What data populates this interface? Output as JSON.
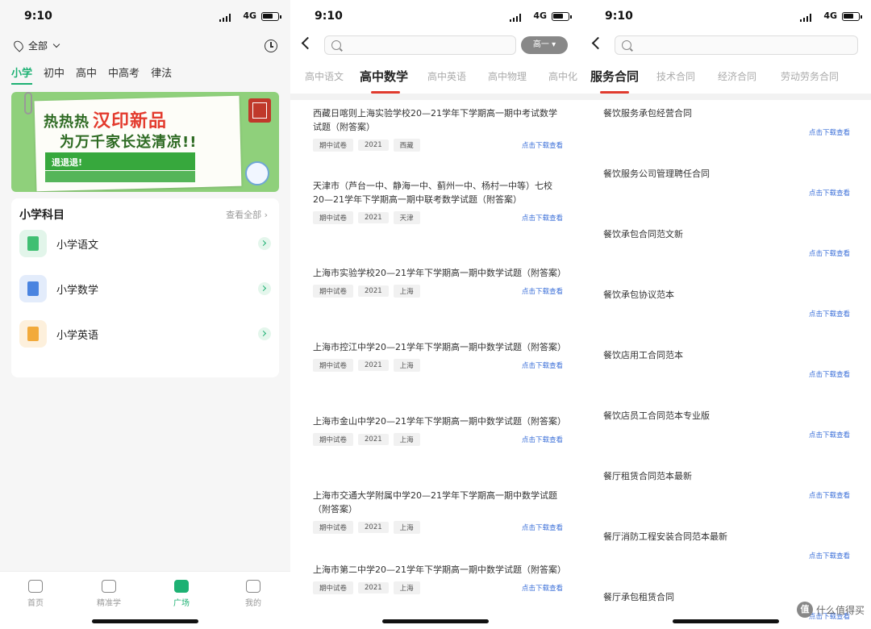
{
  "status": {
    "time": "9:10",
    "network": "4G"
  },
  "home": {
    "location": "全部",
    "level_tabs": [
      "小学",
      "初中",
      "高中",
      "中高考",
      "律法"
    ],
    "active_level": 0,
    "banner": {
      "prefix": "热热热",
      "title": "汉印新品",
      "subtitle": "为万千家长送清凉!!",
      "strip": "退退退!"
    },
    "subjects_title": "小学科目",
    "view_all": "查看全部",
    "subjects": [
      {
        "label": "小学语文",
        "icon": "book-icon",
        "color": "green"
      },
      {
        "label": "小学数学",
        "icon": "calculator-icon",
        "color": "blue"
      },
      {
        "label": "小学英语",
        "icon": "notebook-icon",
        "color": "orange"
      }
    ],
    "tabbar": [
      {
        "label": "首页",
        "icon": "home-icon"
      },
      {
        "label": "精准学",
        "icon": "graduation-cap-icon"
      },
      {
        "label": "广场",
        "icon": "plaza-icon"
      },
      {
        "label": "我的",
        "icon": "profile-icon"
      }
    ],
    "active_tab": 2
  },
  "math": {
    "grade_button": "高一 ▾",
    "categories": [
      "高中语文",
      "高中数学",
      "高中英语",
      "高中物理",
      "高中化"
    ],
    "active_category": 1,
    "download_label": "点击下载查看",
    "docs": [
      {
        "title": "西藏日喀则上海实验学校20—21学年下学期高一期中考试数学试题（附答案）",
        "tags": [
          "期中试卷",
          "2021",
          "西藏"
        ]
      },
      {
        "title": "天津市（芦台一中、静海一中、蓟州一中、杨村一中等）七校20—21学年下学期高一期中联考数学试题（附答案）",
        "tags": [
          "期中试卷",
          "2021",
          "天津"
        ]
      },
      {
        "title": "上海市实验学校20—21学年下学期高一期中数学试题（附答案）",
        "tags": [
          "期中试卷",
          "2021",
          "上海"
        ]
      },
      {
        "title": "上海市控江中学20—21学年下学期高一期中数学试题（附答案）",
        "tags": [
          "期中试卷",
          "2021",
          "上海"
        ]
      },
      {
        "title": "上海市金山中学20—21学年下学期高一期中数学试题（附答案）",
        "tags": [
          "期中试卷",
          "2021",
          "上海"
        ]
      },
      {
        "title": "上海市交通大学附属中学20—21学年下学期高一期中数学试题（附答案）",
        "tags": [
          "期中试卷",
          "2021",
          "上海"
        ]
      },
      {
        "title": "上海市第二中学20—21学年下学期高一期中数学试题（附答案）",
        "tags": [
          "期中试卷",
          "2021",
          "上海"
        ]
      }
    ]
  },
  "contracts": {
    "categories": [
      "服务合同",
      "技术合同",
      "经济合同",
      "劳动劳务合同"
    ],
    "active_category": 0,
    "download_label": "点击下载查看",
    "items": [
      "餐饮服务承包经营合同",
      "餐饮服务公司管理聘任合同",
      "餐饮承包合同范文新",
      "餐饮承包协议范本",
      "餐饮店用工合同范本",
      "餐饮店员工合同范本专业版",
      "餐厅租赁合同范本最新",
      "餐厅消防工程安装合同范本最新",
      "餐厅承包租赁合同"
    ]
  },
  "watermark": {
    "logo": "值",
    "text": "什么值得买"
  }
}
